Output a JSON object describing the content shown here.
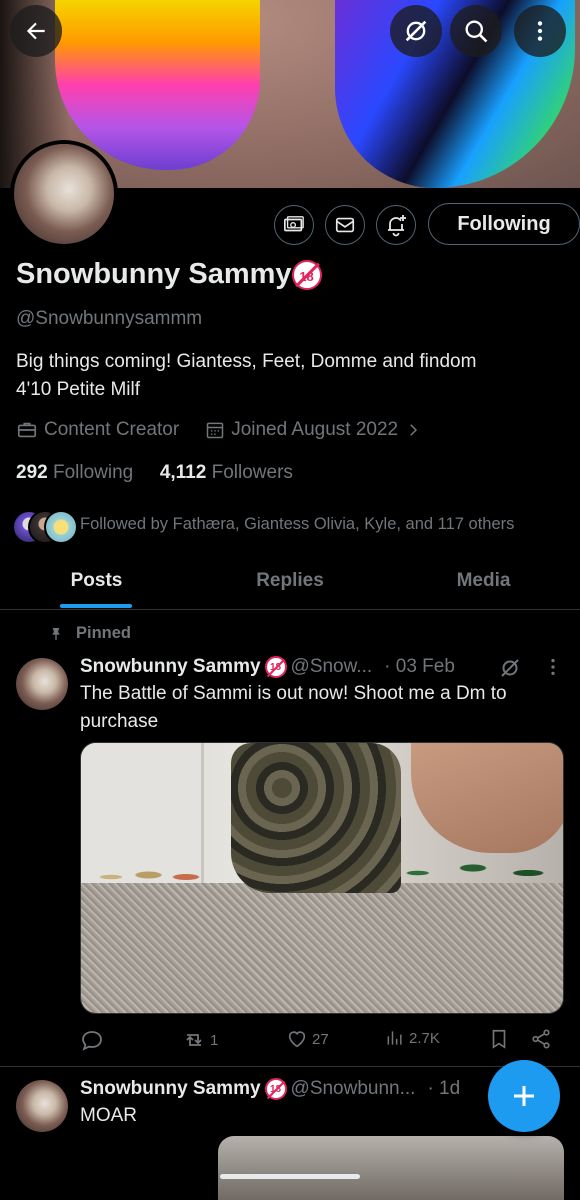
{
  "profile": {
    "name": "Snowbunny Sammy",
    "badge": "18",
    "badge_top_text": "UNDER",
    "handle": "@Snowbunnysammm",
    "bio_line1": "Big things coming!  Giantess, Feet, Domme and findom",
    "bio_line2": "4'10 Petite Milf",
    "category": "Content Creator",
    "joined": "Joined August 2022",
    "following_count": "292",
    "following_label": "Following",
    "followers_count": "4,112",
    "followers_label": "Followers",
    "followed_by": "Followed by Fathæra, Giantess Olivia, Kyle, and 117 others",
    "follow_button": "Following"
  },
  "tabs": [
    {
      "label": "Posts",
      "active": true
    },
    {
      "label": "Replies",
      "active": false
    },
    {
      "label": "Media",
      "active": false
    }
  ],
  "pinned_label": "Pinned",
  "tweets": [
    {
      "name": "Snowbunny Sammy",
      "handle": "@Snow...",
      "date": "· 03 Feb",
      "text_line1": "The Battle of Sammi is out now! Shoot me a Dm to",
      "text_line2": "purchase",
      "retweets": "1",
      "likes": "27",
      "views": "2.7K"
    },
    {
      "name": "Snowbunny Sammy",
      "handle": "@Snowbunn...",
      "date": "· 1d",
      "text": "MOAR"
    }
  ],
  "colors": {
    "accent": "#1d9bf0",
    "text": "#e7e9ea",
    "muted": "#71767b",
    "border": "#2f3336",
    "badge_red": "#e0245e"
  }
}
